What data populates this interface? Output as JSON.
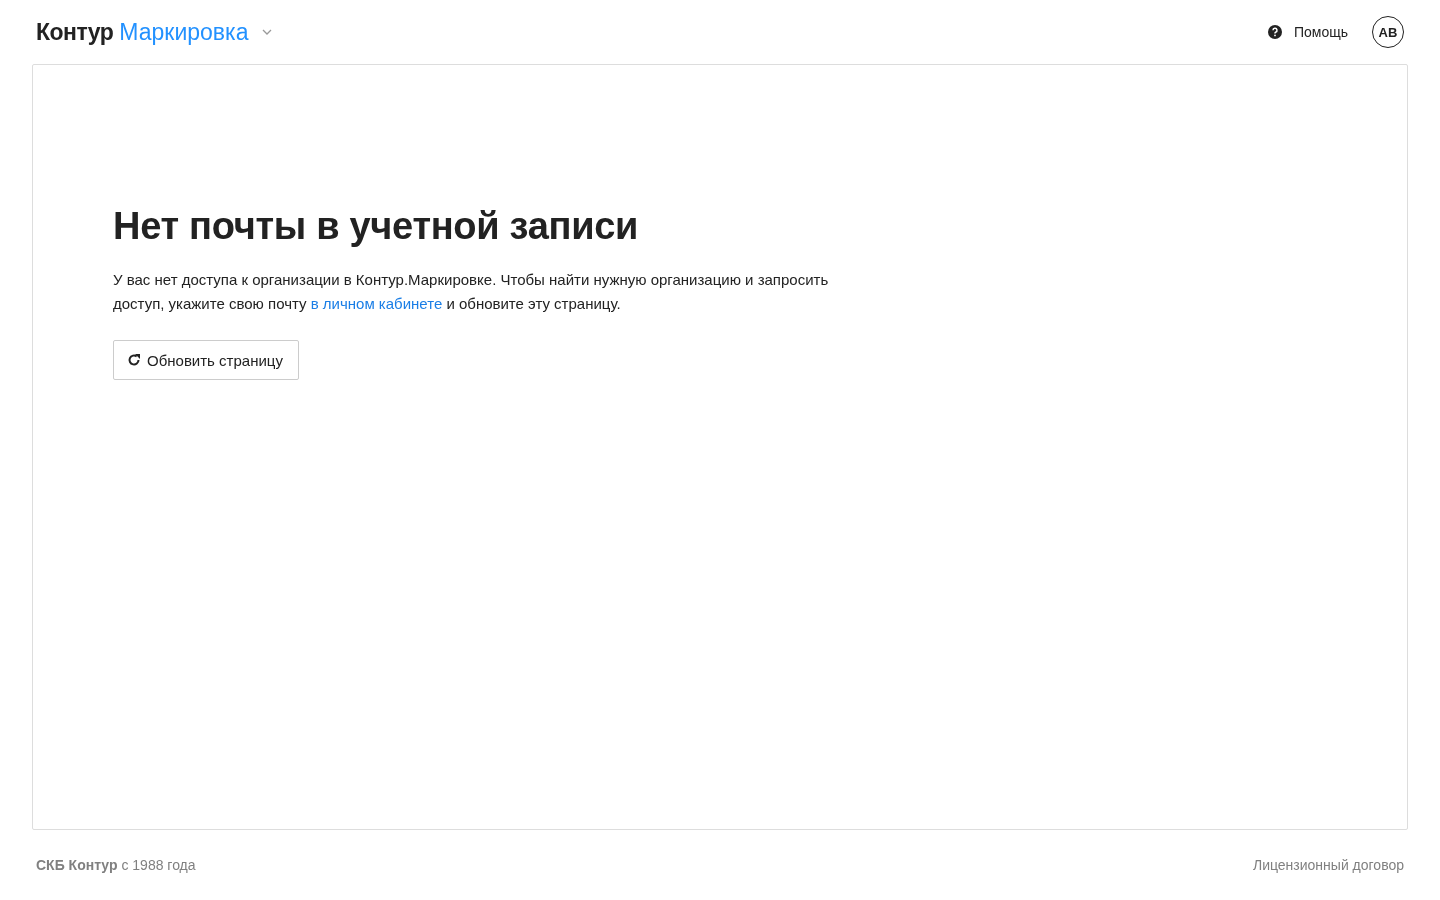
{
  "header": {
    "brand": "Контур",
    "product": "Маркировка",
    "help": "Помощь",
    "avatar": "AB"
  },
  "content": {
    "title": "Нет почты в учетной записи",
    "message_before": "У вас нет доступа к организации в Контур.Маркировке. Чтобы найти нужную организацию и запросить доступ, укажите свою почту",
    "message_link": "в личном кабинете",
    "message_after": "и обновите эту страницу.",
    "button": "Обновить страницу"
  },
  "footer": {
    "copyright": "**СКБ Контур** с 1988 года",
    "license": "Лицензионный договор"
  }
}
